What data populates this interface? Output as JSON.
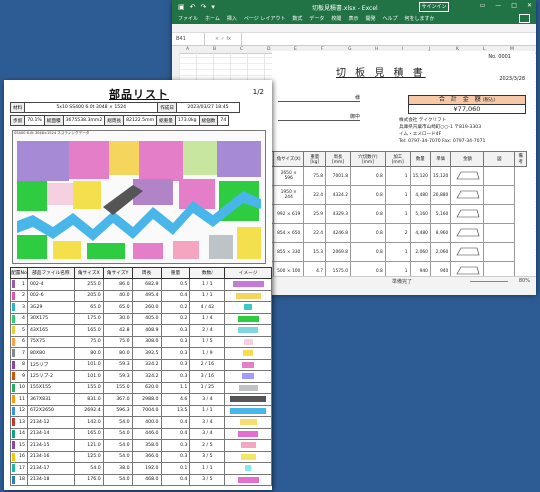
{
  "excel": {
    "title": "切板見積書.xlsx - Excel",
    "signin": "サインイン",
    "menu": [
      "ファイル",
      "ホーム",
      "挿入",
      "ページ レイアウト",
      "数式",
      "データ",
      "校閲",
      "表示",
      "開発",
      "ヘルプ",
      "何をしますか"
    ],
    "namebox": "B41",
    "fx": "× ✓ fx",
    "columns": [
      "A",
      "B",
      "C",
      "D",
      "E",
      "F",
      "G",
      "H",
      "I",
      "J",
      "K",
      "L",
      "M"
    ],
    "quote": {
      "no": "No. 0001",
      "title": "切 板 見 積 書",
      "date": "2023/3/28",
      "subject_suffix": "様",
      "subject2_suffix": "御中",
      "total_label": "合 計 金 額",
      "total_tax": "(税込)",
      "total_value": "¥77,060",
      "company": [
        "株式会社 テイクリフト",
        "兵庫県宍粟市山崎町○○-1 〒819-3303",
        "イム・エメロード4F",
        "Tel: 0797-34-7070 Fax: 0797-34-7071"
      ],
      "headers": [
        "寸 法",
        "角サイズ(X)",
        "重量 [kg]",
        "周長 [mm]",
        "穴切数(Y) [mm]",
        "加工 [mm]",
        "数量",
        "単価",
        "金額",
        "図",
        "備考"
      ],
      "rows": [
        {
          "size": "2650 × 596",
          "w": "75.8",
          "p": "7001.8",
          "a": "0.8",
          "q": "1",
          "u": "15,120",
          "amt": "15,120"
        },
        {
          "size": "1950 × 244",
          "w": "22.4",
          "p": "4324.2",
          "a": "0.8",
          "q": "1",
          "u": "4,480",
          "amt": "26,880"
        },
        {
          "size": "992 × 619",
          "w": "25.9",
          "p": "4329.3",
          "a": "0.8",
          "q": "1",
          "u": "5,160",
          "amt": "5,160"
        },
        {
          "size": "854 × 650",
          "w": "22.4",
          "p": "4246.8",
          "a": "0.8",
          "q": "2",
          "u": "4,480",
          "amt": "8,960"
        },
        {
          "size": "855 × 330",
          "w": "15.3",
          "p": "2069.8",
          "a": "0.8",
          "q": "1",
          "u": "2,060",
          "amt": "2,060"
        },
        {
          "size": "500 × 100",
          "w": "4.7",
          "p": "1575.0",
          "a": "0.8",
          "q": "1",
          "u": "940",
          "amt": "940"
        }
      ]
    },
    "status": {
      "ready": "準備完了",
      "zoom": "80%",
      "sheet": "見積書"
    }
  },
  "doc": {
    "title": "部品リスト",
    "page": "1/2",
    "info_row1": {
      "l1": "材料",
      "v1": "5x10 SS400 6.0t 3048 × 1524",
      "l2": "作成日",
      "v2": "2023/03/27 18:45"
    },
    "info_row2": {
      "l1": "歩留",
      "v1": "70.1%",
      "l2": "総面積",
      "v2": "3675538.3mm2",
      "l3": "総周長",
      "v3": "82122.5mm",
      "l4": "総重量",
      "v4": "173.0kg",
      "l5": "総個数",
      "v5": "74"
    },
    "nest_caption": "SS400 6.0t 3048×1524 ネスティングデータ",
    "headers": [
      "配置No",
      "部品ファイル名称",
      "角サイズX",
      "角サイズY",
      "周長",
      "重量",
      "数数/",
      "イメージ"
    ],
    "rows": [
      {
        "no": "1",
        "name": "002-4",
        "x": "255.0",
        "y": "86.0",
        "p": "682.9",
        "w": "0.5",
        "n": "1 / 1",
        "color": "#9b59b6",
        "img": "#c678dd"
      },
      {
        "no": "2",
        "name": "002-6",
        "x": "205.0",
        "y": "40.0",
        "p": "495.4",
        "w": "0.4",
        "n": "1 / 1",
        "color": "#e056a0",
        "img": "#f6d55c"
      },
      {
        "no": "3",
        "name": "3G29",
        "x": "65.0",
        "y": "65.0",
        "p": "260.0",
        "w": "0.2",
        "n": "4 / 42",
        "color": "#2bb5c9",
        "img": "#3ec8c8"
      },
      {
        "no": "4",
        "name": "30X175",
        "x": "175.0",
        "y": "30.0",
        "p": "405.0",
        "w": "0.2",
        "n": "1 / 4",
        "color": "#2ecc71",
        "img": "#2ecc40"
      },
      {
        "no": "5",
        "name": "43X165",
        "x": "165.0",
        "y": "42.8",
        "p": "408.9",
        "w": "0.3",
        "n": "2 / 4",
        "color": "#e0d040",
        "img": "#7ed6df"
      },
      {
        "no": "6",
        "name": "75X75",
        "x": "75.0",
        "y": "75.0",
        "p": "308.0",
        "w": "0.3",
        "n": "1 / 5",
        "color": "#ff9f43",
        "img": "#f5d0e0"
      },
      {
        "no": "7",
        "name": "80X80",
        "x": "80.0",
        "y": "80.0",
        "p": "392.5",
        "w": "0.3",
        "n": "1 / 9",
        "color": "#7f8c8d",
        "img": "#f4e04d"
      },
      {
        "no": "8",
        "name": "125リブ",
        "x": "101.0",
        "y": "59.3",
        "p": "324.2",
        "w": "0.3",
        "n": "2 / 16",
        "color": "#8e44ad",
        "img": "#e57ec8"
      },
      {
        "no": "9",
        "name": "125リブ-2",
        "x": "101.0",
        "y": "59.3",
        "p": "324.2",
        "w": "0.3",
        "n": "3 / 16",
        "color": "#d35400",
        "img": "#a29bfe"
      },
      {
        "no": "10",
        "name": "155X155",
        "x": "155.0",
        "y": "155.0",
        "p": "620.0",
        "w": "1.1",
        "n": "1 / 25",
        "color": "#27ae60",
        "img": "#bdc3c7"
      },
      {
        "no": "11",
        "name": "367X831",
        "x": "831.0",
        "y": "367.0",
        "p": "2988.0",
        "w": "4.6",
        "n": "3 / 4",
        "color": "#f39c12",
        "img": "#555555"
      },
      {
        "no": "12",
        "name": "672X2650",
        "x": "2692.4",
        "y": "596.3",
        "p": "7004.0",
        "w": "13.5",
        "n": "1 / 1",
        "color": "#3498db",
        "img": "#48b6e8"
      },
      {
        "no": "13",
        "name": "2134-12",
        "x": "142.0",
        "y": "54.0",
        "p": "400.0",
        "w": "0.4",
        "n": "3 / 4",
        "color": "#c0392b",
        "img": "#f7dc6f"
      },
      {
        "no": "14",
        "name": "2134-14",
        "x": "165.0",
        "y": "54.0",
        "p": "446.0",
        "w": "0.4",
        "n": "3 / 4",
        "color": "#16a085",
        "img": "#e56fd0"
      },
      {
        "no": "15",
        "name": "2134-15",
        "x": "121.0",
        "y": "54.0",
        "p": "358.0",
        "w": "0.3",
        "n": "2 / 5",
        "color": "#8e44ad",
        "img": "#f6a5c0"
      },
      {
        "no": "16",
        "name": "2134-16",
        "x": "125.0",
        "y": "54.0",
        "p": "366.0",
        "w": "0.3",
        "n": "3 / 5",
        "color": "#f1c40f",
        "img": "#f5e663"
      },
      {
        "no": "17",
        "name": "2134-17",
        "x": "54.0",
        "y": "38.0",
        "p": "192.0",
        "w": "0.1",
        "n": "1 / 1",
        "color": "#1abc9c",
        "img": "#81ecec"
      },
      {
        "no": "18",
        "name": "2134-18",
        "x": "176.0",
        "y": "54.0",
        "p": "468.0",
        "w": "0.4",
        "n": "3 / 5",
        "color": "#2980b9",
        "img": "#e56fd0"
      }
    ]
  }
}
